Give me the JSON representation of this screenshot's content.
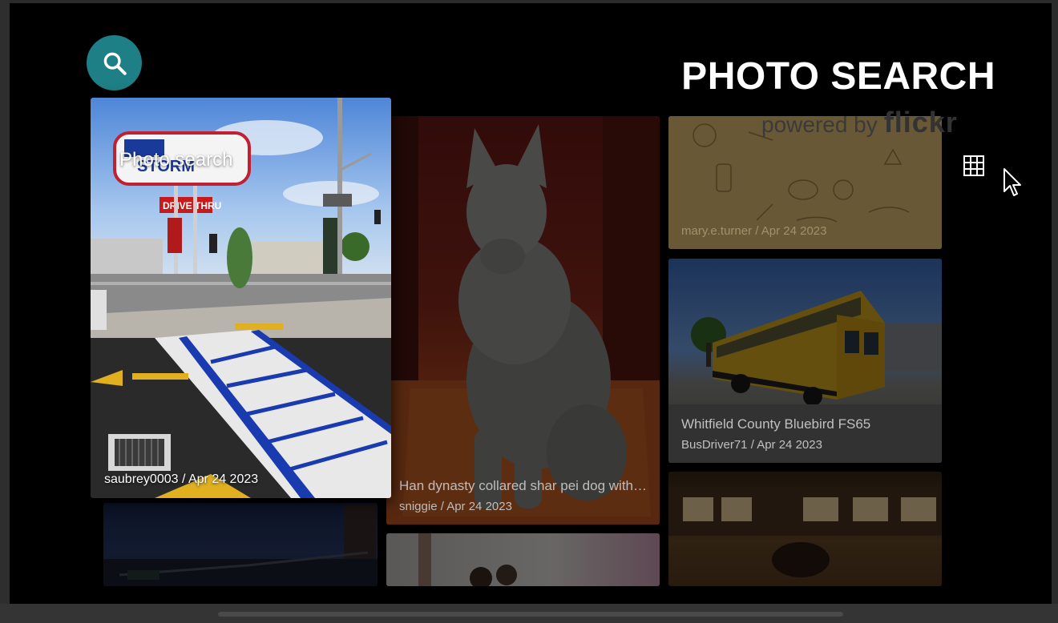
{
  "header": {
    "title": "PHOTO SEARCH",
    "powered_by": "powered by",
    "brand": "flickr",
    "search_icon": "search-icon",
    "grid_icon": "grid-view-icon"
  },
  "featured": {
    "caption": "Photo search",
    "meta": "saubrey0003 / Apr 24 2023"
  },
  "cards": [
    {
      "title": "Han dynasty collared shar pei dog with v...",
      "meta": "sniggie / Apr 24 2023"
    },
    {
      "title": "",
      "meta": "mary.e.turner / Apr 24 2023"
    },
    {
      "title": "Whitfield County Bluebird FS65",
      "meta": "BusDriver71 / Apr 24 2023"
    }
  ],
  "colors": {
    "search_button": "#1f7f86",
    "background": "#000000"
  }
}
